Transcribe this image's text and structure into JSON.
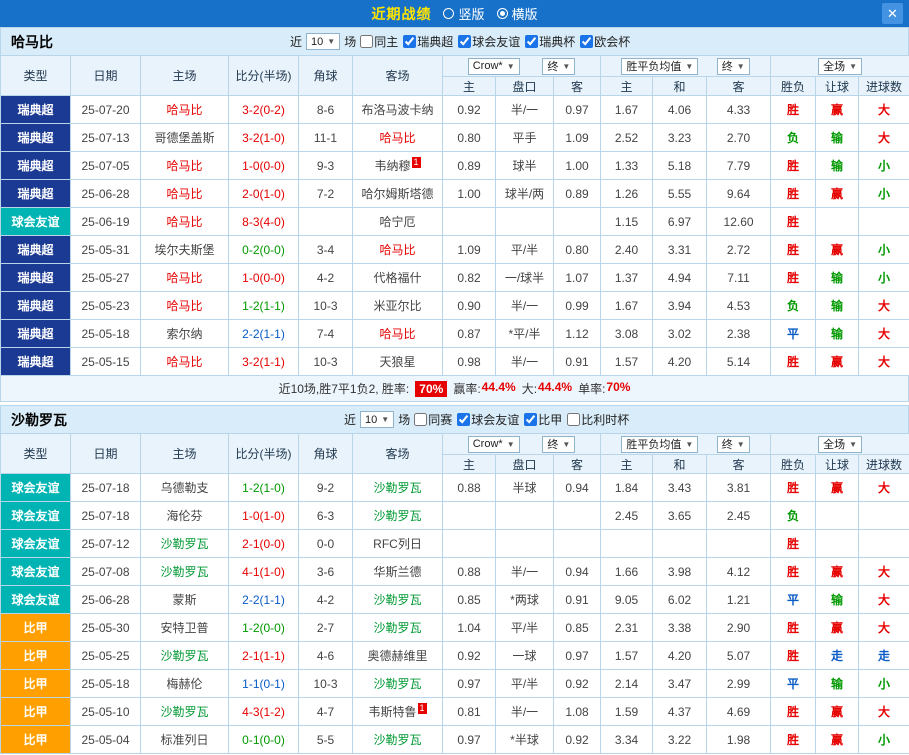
{
  "icons": {
    "dropdown_arrow": "▼",
    "close": "✕"
  },
  "titlebar": {
    "title": "近期战绩",
    "vertical_label": "竖版",
    "horizontal_label": "横版",
    "selected_layout": "横版"
  },
  "columns": {
    "type": "类型",
    "date": "日期",
    "home": "主场",
    "score": "比分(半场)",
    "corner": "角球",
    "away": "客场",
    "o_home": "主",
    "o_line": "盘口",
    "o_away": "客",
    "a_home": "主",
    "a_draw": "和",
    "a_away": "客",
    "res": "胜负",
    "handicap": "让球",
    "goals": "进球数"
  },
  "dropdowns": {
    "company": "Crow*",
    "final": "终",
    "avg": "胜平负均值",
    "scope": "全场"
  },
  "sections": [
    {
      "team": "哈马比",
      "near_label": "近",
      "match_count": "10",
      "games_label": "场",
      "filters": [
        {
          "label": "同主",
          "checked": false
        },
        {
          "label": "瑞典超",
          "checked": true
        },
        {
          "label": "球会友谊",
          "checked": true
        },
        {
          "label": "瑞典杯",
          "checked": true
        },
        {
          "label": "欧会杯",
          "checked": true
        }
      ],
      "rows": [
        [
          {
            "t": "瑞典超",
            "c": "lg-super"
          },
          {
            "t": "25-07-20"
          },
          {
            "t": "哈马比",
            "c": "t-red"
          },
          {
            "t": "3-2(0-2)",
            "c": "sc-w"
          },
          {
            "t": "8-6"
          },
          {
            "t": "布洛马波卡纳"
          },
          {
            "t": "0.92"
          },
          {
            "t": "半/一"
          },
          {
            "t": "0.97"
          },
          {
            "t": "1.67"
          },
          {
            "t": "4.06"
          },
          {
            "t": "4.33"
          },
          {
            "t": "胜",
            "c": "r"
          },
          {
            "t": "赢",
            "c": "r"
          },
          {
            "t": "大",
            "c": "r"
          }
        ],
        [
          {
            "t": "瑞典超",
            "c": "lg-super"
          },
          {
            "t": "25-07-13"
          },
          {
            "t": "哥德堡盖斯"
          },
          {
            "t": "3-2(1-0)",
            "c": "sc-w"
          },
          {
            "t": "11-1"
          },
          {
            "t": "哈马比",
            "c": "t-red"
          },
          {
            "t": "0.80"
          },
          {
            "t": "平手"
          },
          {
            "t": "1.09"
          },
          {
            "t": "2.52"
          },
          {
            "t": "3.23"
          },
          {
            "t": "2.70"
          },
          {
            "t": "负",
            "c": "g"
          },
          {
            "t": "输",
            "c": "g"
          },
          {
            "t": "大",
            "c": "r"
          }
        ],
        [
          {
            "t": "瑞典超",
            "c": "lg-super"
          },
          {
            "t": "25-07-05"
          },
          {
            "t": "哈马比",
            "c": "t-red"
          },
          {
            "t": "1-0(0-0)",
            "c": "sc-w"
          },
          {
            "t": "9-3"
          },
          {
            "t": "韦纳穆",
            "sup": "1"
          },
          {
            "t": "0.89"
          },
          {
            "t": "球半"
          },
          {
            "t": "1.00"
          },
          {
            "t": "1.33"
          },
          {
            "t": "5.18"
          },
          {
            "t": "7.79"
          },
          {
            "t": "胜",
            "c": "r"
          },
          {
            "t": "输",
            "c": "g"
          },
          {
            "t": "小",
            "c": "g"
          }
        ],
        [
          {
            "t": "瑞典超",
            "c": "lg-super"
          },
          {
            "t": "25-06-28"
          },
          {
            "t": "哈马比",
            "c": "t-red"
          },
          {
            "t": "2-0(1-0)",
            "c": "sc-w"
          },
          {
            "t": "7-2"
          },
          {
            "t": "哈尔姆斯塔德"
          },
          {
            "t": "1.00"
          },
          {
            "t": "球半/两"
          },
          {
            "t": "0.89"
          },
          {
            "t": "1.26"
          },
          {
            "t": "5.55"
          },
          {
            "t": "9.64"
          },
          {
            "t": "胜",
            "c": "r"
          },
          {
            "t": "赢",
            "c": "r"
          },
          {
            "t": "小",
            "c": "g"
          }
        ],
        [
          {
            "t": "球会友谊",
            "c": "lg-friendly"
          },
          {
            "t": "25-06-19"
          },
          {
            "t": "哈马比",
            "c": "t-red"
          },
          {
            "t": "8-3(4-0)",
            "c": "sc-w"
          },
          {
            "t": ""
          },
          {
            "t": "哈宁厄"
          },
          {
            "t": ""
          },
          {
            "t": ""
          },
          {
            "t": ""
          },
          {
            "t": "1.15"
          },
          {
            "t": "6.97"
          },
          {
            "t": "12.60"
          },
          {
            "t": "胜",
            "c": "r"
          },
          {
            "t": ""
          },
          {
            "t": ""
          }
        ],
        [
          {
            "t": "瑞典超",
            "c": "lg-super"
          },
          {
            "t": "25-05-31"
          },
          {
            "t": "埃尔夫斯堡"
          },
          {
            "t": "0-2(0-0)",
            "c": "sc-l"
          },
          {
            "t": "3-4"
          },
          {
            "t": "哈马比",
            "c": "t-red"
          },
          {
            "t": "1.09"
          },
          {
            "t": "平/半"
          },
          {
            "t": "0.80"
          },
          {
            "t": "2.40"
          },
          {
            "t": "3.31"
          },
          {
            "t": "2.72"
          },
          {
            "t": "胜",
            "c": "r"
          },
          {
            "t": "赢",
            "c": "r"
          },
          {
            "t": "小",
            "c": "g"
          }
        ],
        [
          {
            "t": "瑞典超",
            "c": "lg-super"
          },
          {
            "t": "25-05-27"
          },
          {
            "t": "哈马比",
            "c": "t-red"
          },
          {
            "t": "1-0(0-0)",
            "c": "sc-w"
          },
          {
            "t": "4-2"
          },
          {
            "t": "代格福什"
          },
          {
            "t": "0.82"
          },
          {
            "t": "一/球半"
          },
          {
            "t": "1.07"
          },
          {
            "t": "1.37"
          },
          {
            "t": "4.94"
          },
          {
            "t": "7.11"
          },
          {
            "t": "胜",
            "c": "r"
          },
          {
            "t": "输",
            "c": "g"
          },
          {
            "t": "小",
            "c": "g"
          }
        ],
        [
          {
            "t": "瑞典超",
            "c": "lg-super"
          },
          {
            "t": "25-05-23"
          },
          {
            "t": "哈马比",
            "c": "t-red"
          },
          {
            "t": "1-2(1-1)",
            "c": "sc-l"
          },
          {
            "t": "10-3"
          },
          {
            "t": "米亚尔比"
          },
          {
            "t": "0.90"
          },
          {
            "t": "半/一"
          },
          {
            "t": "0.99"
          },
          {
            "t": "1.67"
          },
          {
            "t": "3.94"
          },
          {
            "t": "4.53"
          },
          {
            "t": "负",
            "c": "g"
          },
          {
            "t": "输",
            "c": "g"
          },
          {
            "t": "大",
            "c": "r"
          }
        ],
        [
          {
            "t": "瑞典超",
            "c": "lg-super"
          },
          {
            "t": "25-05-18"
          },
          {
            "t": "索尔纳"
          },
          {
            "t": "2-2(1-1)",
            "c": "sc-d"
          },
          {
            "t": "7-4"
          },
          {
            "t": "哈马比",
            "c": "t-red"
          },
          {
            "t": "0.87"
          },
          {
            "t": "*平/半"
          },
          {
            "t": "1.12"
          },
          {
            "t": "3.08"
          },
          {
            "t": "3.02"
          },
          {
            "t": "2.38"
          },
          {
            "t": "平",
            "c": "b"
          },
          {
            "t": "输",
            "c": "g"
          },
          {
            "t": "大",
            "c": "r"
          }
        ],
        [
          {
            "t": "瑞典超",
            "c": "lg-super"
          },
          {
            "t": "25-05-15"
          },
          {
            "t": "哈马比",
            "c": "t-red"
          },
          {
            "t": "3-2(1-1)",
            "c": "sc-w"
          },
          {
            "t": "10-3"
          },
          {
            "t": "天狼星"
          },
          {
            "t": "0.98"
          },
          {
            "t": "半/一"
          },
          {
            "t": "0.91"
          },
          {
            "t": "1.57"
          },
          {
            "t": "4.20"
          },
          {
            "t": "5.14"
          },
          {
            "t": "胜",
            "c": "r"
          },
          {
            "t": "赢",
            "c": "r"
          },
          {
            "t": "大",
            "c": "r"
          }
        ]
      ],
      "summary": {
        "prefix": "近10场,胜7平1负2, 胜率:",
        "win_rate": "70%",
        "items": [
          {
            "label": "赢率:",
            "value": "44.4%"
          },
          {
            "label": "大:",
            "value": "44.4%"
          },
          {
            "label": "单率:",
            "value": "70%"
          }
        ]
      }
    },
    {
      "team": "沙勒罗瓦",
      "near_label": "近",
      "match_count": "10",
      "games_label": "场",
      "filters": [
        {
          "label": "同赛",
          "checked": false
        },
        {
          "label": "球会友谊",
          "checked": true
        },
        {
          "label": "比甲",
          "checked": true
        },
        {
          "label": "比利时杯",
          "checked": false
        }
      ],
      "rows": [
        [
          {
            "t": "球会友谊",
            "c": "lg-friendly"
          },
          {
            "t": "25-07-18"
          },
          {
            "t": "乌德勒支"
          },
          {
            "t": "1-2(1-0)",
            "c": "sc-l"
          },
          {
            "t": "9-2"
          },
          {
            "t": "沙勒罗瓦",
            "c": "t-green"
          },
          {
            "t": "0.88"
          },
          {
            "t": "半球"
          },
          {
            "t": "0.94"
          },
          {
            "t": "1.84"
          },
          {
            "t": "3.43"
          },
          {
            "t": "3.81"
          },
          {
            "t": "胜",
            "c": "r"
          },
          {
            "t": "赢",
            "c": "r"
          },
          {
            "t": "大",
            "c": "r"
          }
        ],
        [
          {
            "t": "球会友谊",
            "c": "lg-friendly"
          },
          {
            "t": "25-07-18"
          },
          {
            "t": "海伦芬"
          },
          {
            "t": "1-0(1-0)",
            "c": "sc-w"
          },
          {
            "t": "6-3"
          },
          {
            "t": "沙勒罗瓦",
            "c": "t-green"
          },
          {
            "t": ""
          },
          {
            "t": ""
          },
          {
            "t": ""
          },
          {
            "t": "2.45"
          },
          {
            "t": "3.65"
          },
          {
            "t": "2.45"
          },
          {
            "t": "负",
            "c": "g"
          },
          {
            "t": ""
          },
          {
            "t": ""
          }
        ],
        [
          {
            "t": "球会友谊",
            "c": "lg-friendly"
          },
          {
            "t": "25-07-12"
          },
          {
            "t": "沙勒罗瓦",
            "c": "t-green"
          },
          {
            "t": "2-1(0-0)",
            "c": "sc-w"
          },
          {
            "t": "0-0"
          },
          {
            "t": "RFC列日"
          },
          {
            "t": ""
          },
          {
            "t": ""
          },
          {
            "t": ""
          },
          {
            "t": ""
          },
          {
            "t": ""
          },
          {
            "t": ""
          },
          {
            "t": "胜",
            "c": "r"
          },
          {
            "t": ""
          },
          {
            "t": ""
          }
        ],
        [
          {
            "t": "球会友谊",
            "c": "lg-friendly"
          },
          {
            "t": "25-07-08"
          },
          {
            "t": "沙勒罗瓦",
            "c": "t-green"
          },
          {
            "t": "4-1(1-0)",
            "c": "sc-w"
          },
          {
            "t": "3-6"
          },
          {
            "t": "华斯兰德"
          },
          {
            "t": "0.88"
          },
          {
            "t": "半/一"
          },
          {
            "t": "0.94"
          },
          {
            "t": "1.66"
          },
          {
            "t": "3.98"
          },
          {
            "t": "4.12"
          },
          {
            "t": "胜",
            "c": "r"
          },
          {
            "t": "赢",
            "c": "r"
          },
          {
            "t": "大",
            "c": "r"
          }
        ],
        [
          {
            "t": "球会友谊",
            "c": "lg-friendly"
          },
          {
            "t": "25-06-28"
          },
          {
            "t": "蒙斯"
          },
          {
            "t": "2-2(1-1)",
            "c": "sc-d"
          },
          {
            "t": "4-2"
          },
          {
            "t": "沙勒罗瓦",
            "c": "t-green"
          },
          {
            "t": "0.85"
          },
          {
            "t": "*两球"
          },
          {
            "t": "0.91"
          },
          {
            "t": "9.05"
          },
          {
            "t": "6.02"
          },
          {
            "t": "1.21"
          },
          {
            "t": "平",
            "c": "b"
          },
          {
            "t": "输",
            "c": "g"
          },
          {
            "t": "大",
            "c": "r"
          }
        ],
        [
          {
            "t": "比甲",
            "c": "lg-jupiler"
          },
          {
            "t": "25-05-30"
          },
          {
            "t": "安特卫普"
          },
          {
            "t": "1-2(0-0)",
            "c": "sc-l"
          },
          {
            "t": "2-7"
          },
          {
            "t": "沙勒罗瓦",
            "c": "t-green"
          },
          {
            "t": "1.04"
          },
          {
            "t": "平/半"
          },
          {
            "t": "0.85"
          },
          {
            "t": "2.31"
          },
          {
            "t": "3.38"
          },
          {
            "t": "2.90"
          },
          {
            "t": "胜",
            "c": "r"
          },
          {
            "t": "赢",
            "c": "r"
          },
          {
            "t": "大",
            "c": "r"
          }
        ],
        [
          {
            "t": "比甲",
            "c": "lg-jupiler"
          },
          {
            "t": "25-05-25"
          },
          {
            "t": "沙勒罗瓦",
            "c": "t-green"
          },
          {
            "t": "2-1(1-1)",
            "c": "sc-w"
          },
          {
            "t": "4-6"
          },
          {
            "t": "奥德赫维里"
          },
          {
            "t": "0.92"
          },
          {
            "t": "一球"
          },
          {
            "t": "0.97"
          },
          {
            "t": "1.57"
          },
          {
            "t": "4.20"
          },
          {
            "t": "5.07"
          },
          {
            "t": "胜",
            "c": "r"
          },
          {
            "t": "走",
            "c": "b"
          },
          {
            "t": "走",
            "c": "b"
          }
        ],
        [
          {
            "t": "比甲",
            "c": "lg-jupiler"
          },
          {
            "t": "25-05-18"
          },
          {
            "t": "梅赫伦"
          },
          {
            "t": "1-1(0-1)",
            "c": "sc-d"
          },
          {
            "t": "10-3"
          },
          {
            "t": "沙勒罗瓦",
            "c": "t-green"
          },
          {
            "t": "0.97"
          },
          {
            "t": "平/半"
          },
          {
            "t": "0.92"
          },
          {
            "t": "2.14"
          },
          {
            "t": "3.47"
          },
          {
            "t": "2.99"
          },
          {
            "t": "平",
            "c": "b"
          },
          {
            "t": "输",
            "c": "g"
          },
          {
            "t": "小",
            "c": "g"
          }
        ],
        [
          {
            "t": "比甲",
            "c": "lg-jupiler"
          },
          {
            "t": "25-05-10"
          },
          {
            "t": "沙勒罗瓦",
            "c": "t-green"
          },
          {
            "t": "4-3(1-2)",
            "c": "sc-w"
          },
          {
            "t": "4-7"
          },
          {
            "t": "韦斯特鲁",
            "sup": "1"
          },
          {
            "t": "0.81"
          },
          {
            "t": "半/一"
          },
          {
            "t": "1.08"
          },
          {
            "t": "1.59"
          },
          {
            "t": "4.37"
          },
          {
            "t": "4.69"
          },
          {
            "t": "胜",
            "c": "r"
          },
          {
            "t": "赢",
            "c": "r"
          },
          {
            "t": "大",
            "c": "r"
          }
        ],
        [
          {
            "t": "比甲",
            "c": "lg-jupiler"
          },
          {
            "t": "25-05-04"
          },
          {
            "t": "标准列日"
          },
          {
            "t": "0-1(0-0)",
            "c": "sc-l"
          },
          {
            "t": "5-5"
          },
          {
            "t": "沙勒罗瓦",
            "c": "t-green"
          },
          {
            "t": "0.97"
          },
          {
            "t": "*半球"
          },
          {
            "t": "0.92"
          },
          {
            "t": "3.34"
          },
          {
            "t": "3.22"
          },
          {
            "t": "1.98"
          },
          {
            "t": "胜",
            "c": "r"
          },
          {
            "t": "赢",
            "c": "r"
          },
          {
            "t": "小",
            "c": "g"
          }
        ]
      ]
    }
  ]
}
